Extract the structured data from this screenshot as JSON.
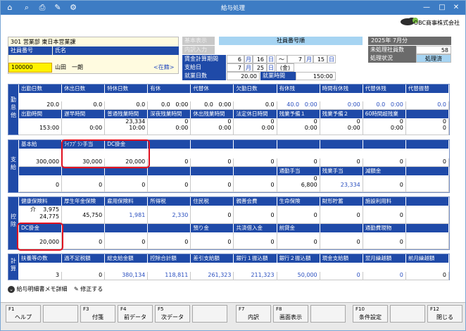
{
  "title": "給与処理",
  "company": "OBC商事株式会社",
  "dept": "301 営業部 東日本営業課",
  "emp": {
    "no_label": "社員番号",
    "name_label": "氏名",
    "no": "100000",
    "name": "山田　一朗",
    "status": "<在籍>"
  },
  "grey_btn1": "基本表示",
  "grey_btn2": "内訳入力",
  "order_label": "社員番号順",
  "period": {
    "label": "賃金計算期間",
    "from_m": "6",
    "from_d": "16",
    "to_m": "7",
    "to_d": "15",
    "m": "月",
    "d": "日",
    "tilde": "～"
  },
  "pay": {
    "label": "支給日",
    "m": "7",
    "d": "25",
    "dow": "(金)"
  },
  "work": {
    "days_label": "就業日数",
    "days": "20.00",
    "hours_label": "就業時間",
    "hours": "150:00"
  },
  "month": {
    "title": "2025年 7月分",
    "unproc_label": "未処理社員数",
    "unproc": "58",
    "status_label": "処理状況",
    "status": "処理済"
  },
  "kintai": {
    "side": [
      "勤",
      "怠",
      "他"
    ],
    "h1": [
      "出勤日数",
      "休出日数",
      "特休日数",
      "有休",
      "代替休",
      "欠勤日数",
      "有休残",
      "時間有休残",
      "代替休残",
      "代替振替"
    ],
    "v1": [
      "20.0",
      "0.0",
      "0.0",
      "0.0   0:00",
      "0.0   0:00",
      "0.0",
      "40.0   0:00",
      "0:00",
      "0.0   0:00",
      "0.0"
    ],
    "h2": [
      "出勤時間",
      "遅早時間",
      "普通残業時間",
      "深夜残業時間",
      "休出残業時間",
      "法定休日時間",
      "残業予備１",
      "残業予備２",
      "60時間超残業",
      ""
    ],
    "v2": [
      "\n153:00",
      "\n0:00",
      "23,334\n10:00",
      "0\n0:00",
      "0\n0:00",
      "0\n0:00",
      "0\n0:00",
      "0\n0:00",
      "0\n0:00",
      "0\n0"
    ]
  },
  "shikyu": {
    "side": [
      "支",
      "給"
    ],
    "h1": [
      "基本給",
      "ﾗｲﾌﾌﾟﾗﾝ手当",
      "DC掛金",
      "",
      "",
      "",
      "",
      "",
      "",
      ""
    ],
    "v1": [
      "300,000",
      "30,000",
      "20,000",
      "0",
      "0",
      "0",
      "0",
      "0",
      "0",
      "0"
    ],
    "h2": [
      "",
      "",
      "",
      "",
      "",
      "",
      "通勤手当",
      "残業手当",
      "減額金",
      ""
    ],
    "v2": [
      "\n0",
      "\n0",
      "\n0",
      "\n0",
      "\n0",
      "\n0",
      "0\n6,800",
      "\n23,334",
      "\n0",
      ""
    ]
  },
  "kojo": {
    "side": [
      "控",
      "除"
    ],
    "h1": [
      "健康保険料",
      "厚生年金保険",
      "雇用保険料",
      "所得税",
      "住民税",
      "親善会費",
      "生命保険",
      "財形貯蓄",
      "施設利用料",
      ""
    ],
    "v1": [
      "介    3,975\n24,775",
      "\n45,750",
      "\n1,981",
      "\n2,330",
      "\n0",
      "\n0",
      "\n0",
      "\n0",
      "\n0",
      ""
    ],
    "h2": [
      "DC掛金",
      "",
      "",
      "",
      "預り金",
      "共済借入金",
      "前貸金",
      "",
      "通勤費現物",
      ""
    ],
    "v2": [
      "\n20,000",
      "\n0",
      "\n0",
      "\n0",
      "\n0",
      "\n0",
      "\n0",
      "\n0",
      "\n0",
      ""
    ]
  },
  "keisan": {
    "side": [
      "計",
      "算"
    ],
    "h1": [
      "扶養等の数",
      "過不足税額",
      "総支給金額",
      "控除合計額",
      "差引支給額",
      "銀行１振込額",
      "銀行２振込額",
      "現金支給額",
      "翌月繰越額",
      "前月繰越額"
    ],
    "v1": [
      "3",
      "0",
      "380,134",
      "118,811",
      "261,323",
      "211,323",
      "50,000",
      "0",
      "0",
      "0"
    ]
  },
  "links": {
    "memo": "給与明細書メモ詳細",
    "edit": "修正する"
  },
  "fkeys": [
    {
      "n": "F1",
      "l": "ヘルプ"
    },
    {
      "n": "",
      "l": ""
    },
    {
      "n": "F3",
      "l": "付箋"
    },
    {
      "n": "F4",
      "l": "前データ"
    },
    {
      "n": "F5",
      "l": "次データ"
    },
    {
      "n": "",
      "l": ""
    },
    {
      "n": "F7",
      "l": "内訳"
    },
    {
      "n": "F8",
      "l": "画面表示"
    },
    {
      "n": "",
      "l": ""
    },
    {
      "n": "F10",
      "l": "条件設定"
    },
    {
      "n": "",
      "l": ""
    },
    {
      "n": "F12",
      "l": "閉じる"
    }
  ]
}
